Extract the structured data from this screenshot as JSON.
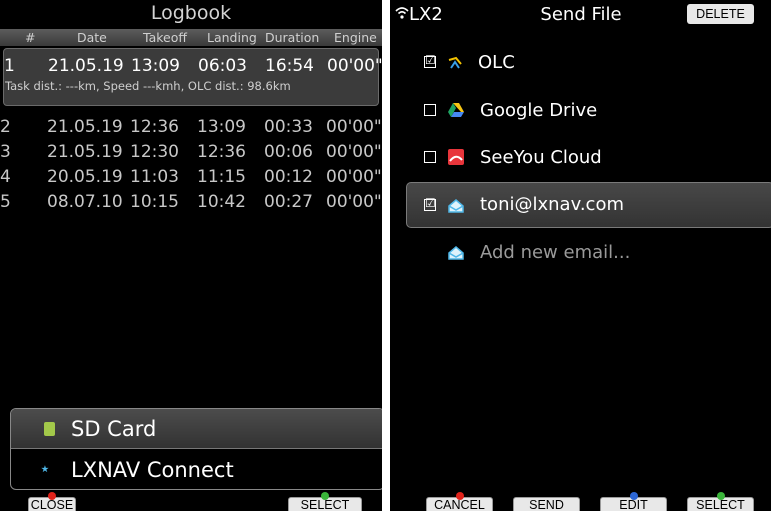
{
  "logbook": {
    "title": "Logbook",
    "columns": [
      "#",
      "Date",
      "Takeoff",
      "Landing",
      "Duration",
      "Engine"
    ],
    "rows": [
      {
        "num": "1",
        "date": "21.05.19",
        "takeoff": "13:09",
        "landing": "06:03",
        "duration": "16:54",
        "engine": "00'00\""
      },
      {
        "num": "2",
        "date": "21.05.19",
        "takeoff": "12:36",
        "landing": "13:09",
        "duration": "00:33",
        "engine": "00'00\""
      },
      {
        "num": "3",
        "date": "21.05.19",
        "takeoff": "12:30",
        "landing": "12:36",
        "duration": "00:06",
        "engine": "00'00\""
      },
      {
        "num": "4",
        "date": "20.05.19",
        "takeoff": "11:03",
        "landing": "11:15",
        "duration": "00:12",
        "engine": "00'00\""
      },
      {
        "num": "5",
        "date": "08.07.10",
        "takeoff": "10:15",
        "landing": "10:42",
        "duration": "00:27",
        "engine": "00'00\""
      }
    ],
    "selected_detail": "Task dist.: ---km, Speed ---kmh, OLC dist.: 98.6km",
    "menu": [
      {
        "label": "SD Card",
        "icon": "sd-card-icon"
      },
      {
        "label": "LXNAV Connect",
        "icon": "lxnav-connect-icon"
      }
    ],
    "softkeys": {
      "close": "CLOSE",
      "select": "SELECT"
    }
  },
  "send_file": {
    "device": "LX2",
    "title": "Send File",
    "delete_label": "DELETE",
    "items": [
      {
        "label": "OLC",
        "checked": true,
        "icon": "olc-icon"
      },
      {
        "label": "Google Drive",
        "checked": false,
        "icon": "google-drive-icon"
      },
      {
        "label": "SeeYou Cloud",
        "checked": false,
        "icon": "seeyou-cloud-icon"
      },
      {
        "label": "toni@lxnav.com",
        "checked": true,
        "icon": "email-icon"
      }
    ],
    "add_email": "Add new email...",
    "softkeys": {
      "cancel": "CANCEL",
      "send": "SEND",
      "edit": "EDIT",
      "select": "SELECT"
    },
    "check_glyph": "☑"
  }
}
